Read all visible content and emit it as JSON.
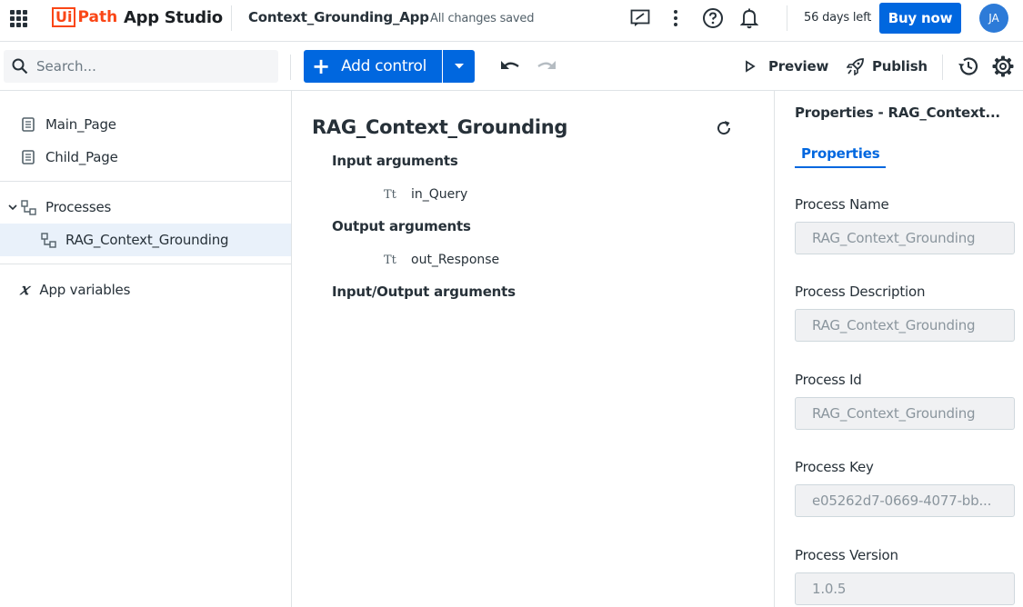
{
  "header": {
    "logo_ui": "Ui",
    "logo_path": "Path",
    "product_name": "App Studio",
    "app_name": "Context_Grounding_App",
    "save_status": "All changes saved",
    "trial_status": "56 days left",
    "buy_label": "Buy now",
    "avatar_initials": "JA"
  },
  "toolbar": {
    "search_placeholder": "Search...",
    "add_control_label": "Add control",
    "preview_label": "Preview",
    "publish_label": "Publish"
  },
  "tree": {
    "pages": [
      "Main_Page",
      "Child_Page"
    ],
    "processes_label": "Processes",
    "process_items": [
      "RAG_Context_Grounding"
    ],
    "app_variables_label": "App variables"
  },
  "main": {
    "title": "RAG_Context_Grounding",
    "input_heading": "Input arguments",
    "input_args": [
      {
        "type_icon": "Tt",
        "name": "in_Query"
      }
    ],
    "output_heading": "Output arguments",
    "output_args": [
      {
        "type_icon": "Tt",
        "name": "out_Response"
      }
    ],
    "inout_heading": "Input/Output arguments"
  },
  "properties": {
    "title": "Properties - RAG_Context...",
    "tab_label": "Properties",
    "fields": [
      {
        "label": "Process Name",
        "value": "RAG_Context_Grounding"
      },
      {
        "label": "Process Description",
        "value": "RAG_Context_Grounding"
      },
      {
        "label": "Process Id",
        "value": "RAG_Context_Grounding"
      },
      {
        "label": "Process Key",
        "value": "e05262d7-0669-4077-bb..."
      },
      {
        "label": "Process Version",
        "value": "1.0.5"
      }
    ]
  },
  "colors": {
    "brand_orange": "#fa4616",
    "primary_blue": "#0067df",
    "selected_bg": "#e9f1fa"
  }
}
